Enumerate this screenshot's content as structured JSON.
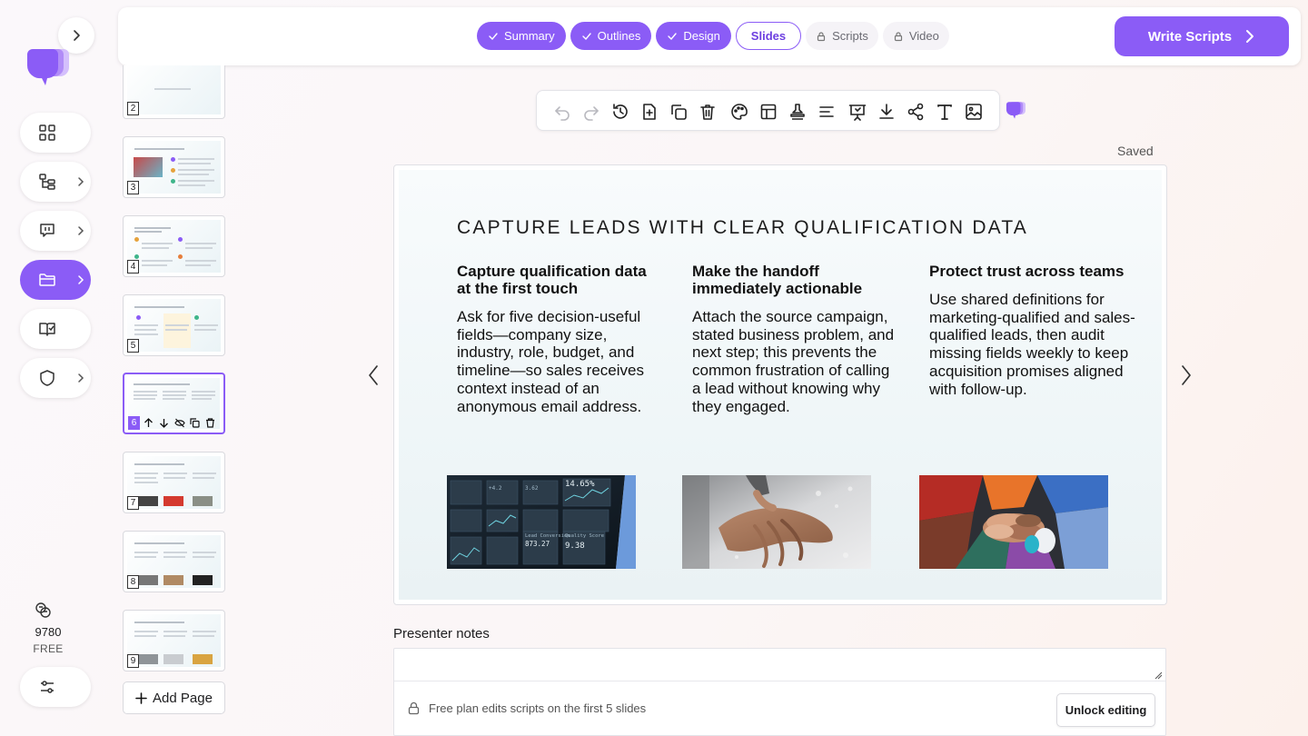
{
  "sidebar": {
    "expand_icon": "chevron-right-icon",
    "items": [
      {
        "name": "dashboard",
        "icon": "grid-icon",
        "has_chevron": false
      },
      {
        "name": "outline",
        "icon": "tree-icon",
        "has_chevron": true
      },
      {
        "name": "chat",
        "icon": "message-icon",
        "has_chevron": true
      },
      {
        "name": "projects",
        "icon": "folder-icon",
        "has_chevron": true,
        "active": true
      },
      {
        "name": "library",
        "icon": "book-check-icon",
        "has_chevron": false
      },
      {
        "name": "security",
        "icon": "shield-icon",
        "has_chevron": true
      }
    ],
    "credits": "9780",
    "plan": "FREE",
    "settings_icon": "sliders-icon"
  },
  "header": {
    "steps": [
      {
        "label": "Summary",
        "state": "done"
      },
      {
        "label": "Outlines",
        "state": "done"
      },
      {
        "label": "Design",
        "state": "done"
      },
      {
        "label": "Slides",
        "state": "current"
      },
      {
        "label": "Scripts",
        "state": "locked"
      },
      {
        "label": "Video",
        "state": "locked"
      }
    ],
    "write_scripts_label": "Write Scripts"
  },
  "thumbnails": {
    "pages": [
      "2",
      "3",
      "4",
      "5",
      "6",
      "7",
      "8",
      "9"
    ],
    "selected": "6",
    "add_page_label": "Add Page"
  },
  "toolbar": {
    "tools": [
      "undo-icon",
      "redo-icon",
      "history-icon",
      "add-slide-icon",
      "duplicate-icon",
      "delete-icon",
      "palette-icon",
      "layout-icon",
      "stamp-icon",
      "align-icon",
      "present-icon",
      "download-icon",
      "share-icon",
      "text-icon",
      "image-icon"
    ],
    "saved_label": "Saved"
  },
  "slide": {
    "title": "CAPTURE LEADS WITH CLEAR QUALIFICATION DATA",
    "columns": [
      {
        "heading": "Capture qualification data at the first touch",
        "body": "Ask for five decision-useful fields—company size, industry, role, budget, and timeline—so sales receives context instead of an anonymous email address.",
        "image": "dashboard-screen-photo"
      },
      {
        "heading": "Make the handoff immediately actionable",
        "body": "Attach the source campaign, stated business problem, and next step; this prevents the common frustration of calling a lead without knowing why they engaged.",
        "image": "hands-working-photo"
      },
      {
        "heading": "Protect trust across teams",
        "body": "Use shared definitions for marketing-qualified and sales-qualified leads, then audit missing fields weekly to keep acquisition promises aligned with follow-up.",
        "image": "team-hands-stack-photo"
      }
    ],
    "photo_text": {
      "percent": "14.65%",
      "small1": "3.62",
      "small2": "+4.2",
      "label1": "Lead Conversion",
      "value1": "873.27",
      "label2": "Quality Score",
      "value2": "9.38"
    }
  },
  "notes": {
    "label": "Presenter notes",
    "value": "",
    "lock_text": "Free plan edits scripts on the first 5 slides",
    "unlock_label": "Unlock editing"
  },
  "colors": {
    "accent": "#8b5cf6",
    "accent_dark": "#6d3fe0"
  }
}
